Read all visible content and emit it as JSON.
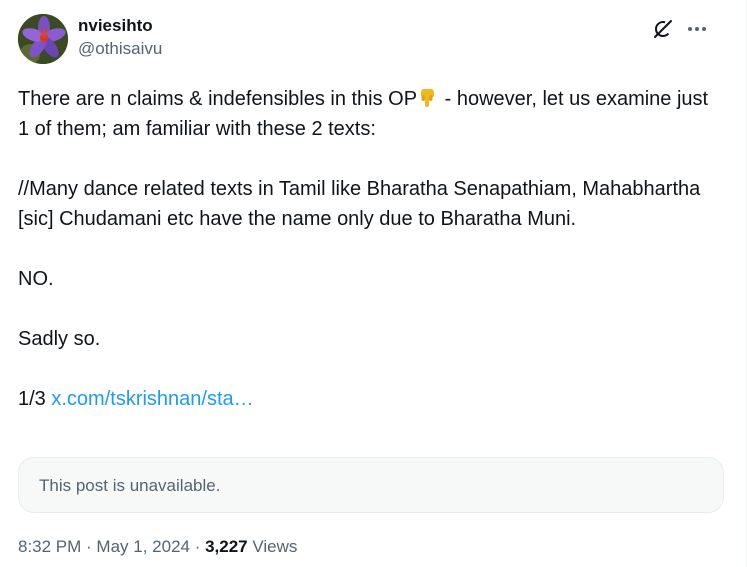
{
  "author": {
    "display_name": "nviesihto",
    "handle": "@othisaivu"
  },
  "post": {
    "line1_pre": "There are n claims & indefensibles in this OP",
    "line1_emoji": "backhand-pointing-down-emoji",
    "line1_post": " - however, let us examine just 1 of them; am familiar with these 2 texts:",
    "para2": "//Many dance related texts in Tamil like Bharatha Senapathiam, Mahabhartha [sic] Chudamani etc have the name only due to Bharatha Muni.",
    "para3": "NO.",
    "para4": "Sadly so.",
    "para5_pre": "1/3 ",
    "para5_link": "x.com/tskrishnan/sta…"
  },
  "quoted": {
    "unavailable_text": "This post is unavailable."
  },
  "meta": {
    "time": "8:32 PM",
    "separator1": " · ",
    "date": "May 1, 2024",
    "separator2": " · ",
    "views_count": "3,227",
    "views_label": " Views"
  },
  "colors": {
    "link": "#1d9bf0",
    "secondary_text": "#536471",
    "primary_text": "#0f1419"
  },
  "icons": {
    "grok": "grok-icon",
    "more": "more-icon"
  }
}
